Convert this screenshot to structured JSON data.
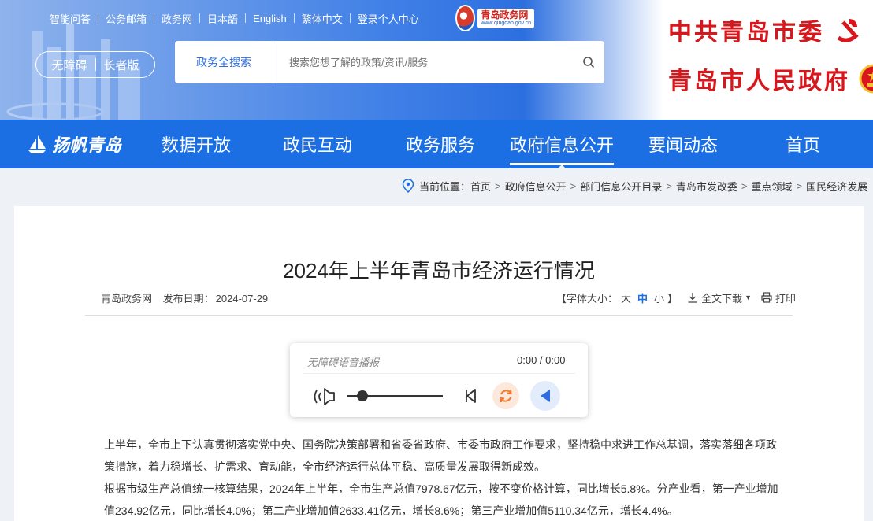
{
  "header": {
    "toplinks": [
      "智能问答",
      "公务邮箱",
      "政务网",
      "日本語",
      "English",
      "繁体中文",
      "登录个人中心"
    ],
    "logo_text": "青岛政务网",
    "logo_url_text": "www.qingdao.gov.cn",
    "mode_options": [
      "无障碍",
      "长者版"
    ],
    "search": {
      "button_label": "政务全搜索",
      "placeholder": "搜索您想了解的政策/资讯/服务"
    },
    "org_party": "中共青岛市委",
    "org_gov": "青岛市人民政府"
  },
  "nav": {
    "brand": "扬帆青岛",
    "items": [
      "数据开放",
      "政民互动",
      "政务服务",
      "政府信息公开",
      "要闻动态",
      "首页"
    ],
    "active": "政府信息公开"
  },
  "breadcrumb": {
    "prefix": "当前位置：",
    "items": [
      "首页",
      "政府信息公开",
      "部门信息公开目录",
      "青岛市发改委",
      "重点领域",
      "国民经济发展"
    ]
  },
  "article": {
    "title": "2024年上半年青岛市经济运行情况",
    "source": "青岛政务网",
    "date_label": "发布日期：",
    "date": "2024-07-29",
    "font_label": "【字体大小：",
    "font_sizes": [
      "大",
      "中",
      "小"
    ],
    "font_close": "】",
    "download_label": "全文下载",
    "print_label": "打印",
    "paragraphs": [
      "上半年，全市上下认真贯彻落实党中央、国务院决策部署和省委省政府、市委市政府工作要求，坚持稳中求进工作总基调，落实落细各项政策措施，着力稳增长、扩需求、育动能，全市经济运行总体平稳、高质量发展取得新成效。",
      "根据市级生产总值统一核算结果，2024年上半年，全市生产总值7978.67亿元，按不变价格计算，同比增长5.8%。分产业看，第一产业增加值234.92亿元，同比增长4.0%；第二产业增加值2633.41亿元，增长8.6%；第三产业增加值5110.34亿元，增长4.4%。"
    ]
  },
  "player": {
    "title": "无障碍语音播报",
    "time": "0:00 / 0:00",
    "progress": 0.16
  },
  "colors": {
    "nav_blue": "#1c6fe3",
    "org_red": "#d8171c",
    "active_size": "#1c6fe3"
  }
}
